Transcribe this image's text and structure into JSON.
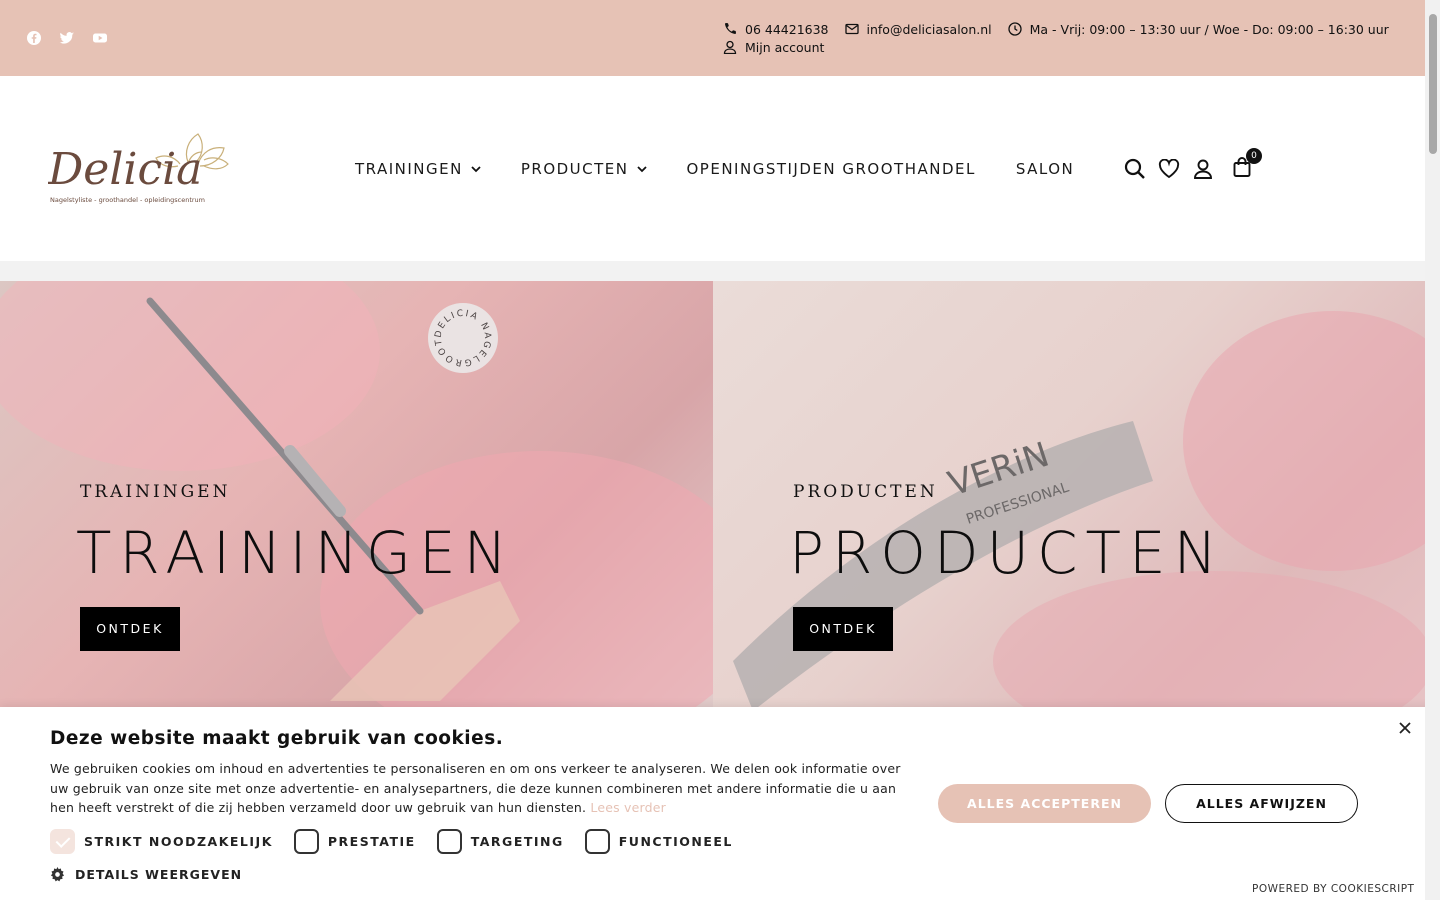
{
  "topbar": {
    "social": [
      {
        "name": "facebook"
      },
      {
        "name": "twitter"
      },
      {
        "name": "youtube"
      }
    ],
    "phone": "06 44421638",
    "email": "info@deliciasalon.nl",
    "hours": "Ma - Vrij: 09:00 – 13:30 uur / Woe - Do: 09:00 – 16:30 uur",
    "account": "Mijn account"
  },
  "header": {
    "logo_text": "Delicia",
    "logo_tagline": "Nagelstyliste - groothandel - opleidingscentrum",
    "nav": [
      {
        "label": "TRAININGEN",
        "has_dropdown": true
      },
      {
        "label": "PRODUCTEN",
        "has_dropdown": true
      },
      {
        "label": "OPENINGSTIJDEN GROOTHANDEL",
        "has_dropdown": false
      },
      {
        "label": "SALON",
        "has_dropdown": false
      }
    ],
    "cart_count": "0"
  },
  "hero": {
    "left": {
      "kicker": "TRAININGEN",
      "title": "TRAININGEN",
      "button": "ONTDEK",
      "stamp_text": "DELICIA NAGELGROOTHANDEL"
    },
    "right": {
      "kicker": "PRODUCTEN",
      "title": "PRODUCTEN",
      "button": "ONTDEK",
      "product_text_1": "VERiN",
      "product_text_2": "PROFESSIONAL"
    }
  },
  "cookie": {
    "title": "Deze website maakt gebruik van cookies.",
    "text": "We gebruiken cookies om inhoud en advertenties te personaliseren en om ons verkeer te analyseren. We delen ook informatie over uw gebruik van onze site met onze advertentie- en analysepartners, die deze kunnen combineren met andere informatie die u aan hen heeft verstrekt of die zij hebben verzameld door uw gebruik van hun diensten.",
    "read_more": "Lees verder",
    "accept": "ALLES ACCEPTEREN",
    "reject": "ALLES AFWIJZEN",
    "checkboxes": [
      {
        "label": "STRIKT NOODZAKELIJK",
        "checked": true
      },
      {
        "label": "PRESTATIE",
        "checked": false
      },
      {
        "label": "TARGETING",
        "checked": false
      },
      {
        "label": "FUNCTIONEEL",
        "checked": false
      }
    ],
    "details": "DETAILS WEERGEVEN",
    "powered": "POWERED BY COOKIESCRIPT"
  },
  "colors": {
    "accent": "#e6c2b5",
    "dark": "#111111"
  }
}
